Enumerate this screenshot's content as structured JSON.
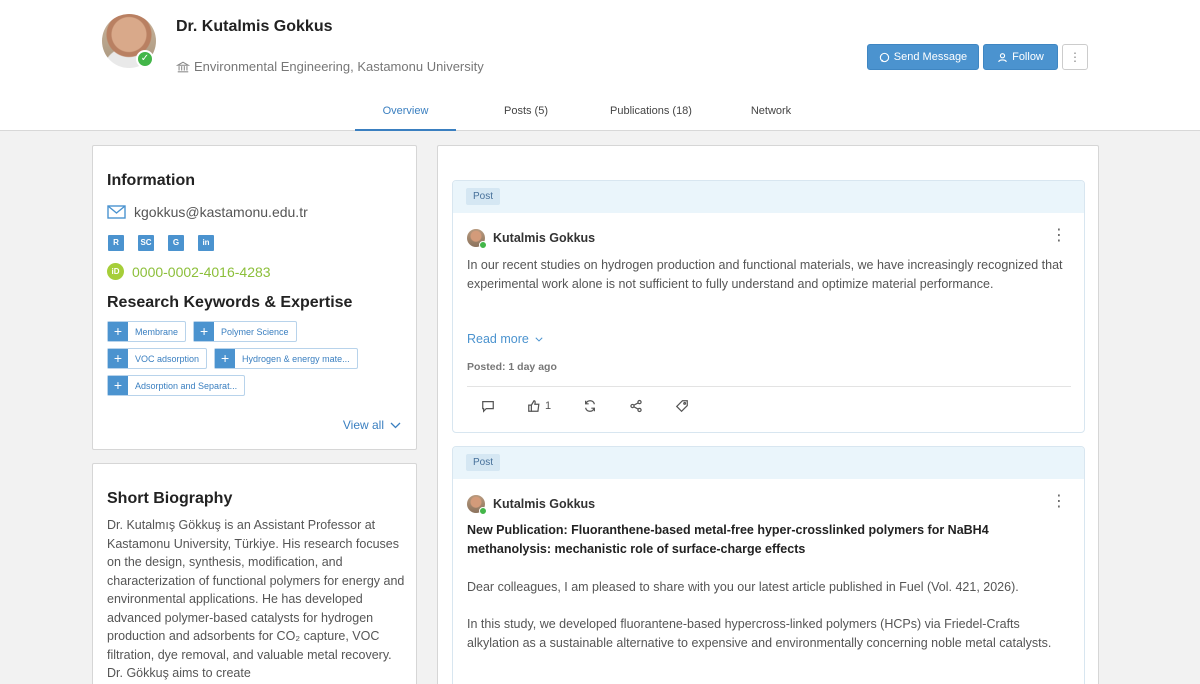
{
  "profile": {
    "name": "Dr. Kutalmis Gokkus",
    "affiliation": "Environmental Engineering, Kastamonu University"
  },
  "actions": {
    "send_message": "Send Message",
    "follow": "Follow",
    "more": "⋮"
  },
  "tabs": [
    {
      "label": "Overview",
      "active": true
    },
    {
      "label": "Posts (5)",
      "active": false
    },
    {
      "label": "Publications (18)",
      "active": false
    },
    {
      "label": "Network",
      "active": false
    }
  ],
  "info": {
    "title": "Information",
    "email": "kgokkus@kastamonu.edu.tr",
    "social": [
      "R",
      "SC",
      "G",
      "in"
    ],
    "orcid_badge": "iD",
    "orcid": "0000-0002-4016-4283",
    "keywords_title": "Research Keywords & Expertise",
    "keywords": [
      "Membrane",
      "Polymer Science",
      "VOC adsorption",
      "Hydrogen & energy mate...",
      "Adsorption and Separat..."
    ],
    "view_all": "View all"
  },
  "bio": {
    "title": "Short Biography",
    "text": "Dr. Kutalmış Gökkuş is an Assistant Professor at Kastamonu University, Türkiye. His research focuses on the design, synthesis, modification, and characterization of functional polymers for energy and environmental applications. He has developed advanced polymer-based catalysts for hydrogen production and adsorbents for CO₂ capture, VOC filtration, dye removal, and valuable metal recovery. Dr. Gökkuş aims to create"
  },
  "posts": [
    {
      "badge": "Post",
      "author": "Kutalmis Gokkus",
      "text": "In our recent studies on hydrogen production and functional materials, we have increasingly recognized that experimental work alone is not sufficient to fully understand and optimize material performance.",
      "read_more": "Read more",
      "posted": "Posted: 1 day ago",
      "likes": "1"
    },
    {
      "badge": "Post",
      "author": "Kutalmis Gokkus",
      "title": "New Publication: Fluoranthene-based metal-free hyper-crosslinked polymers for NaBH4 methanolysis: mechanistic role of surface-charge effects",
      "para1": "Dear colleagues, I am pleased to share with you our latest article published in Fuel (Vol. 421, 2026).",
      "para2": "In this study, we developed fluorantene-based hypercross-linked polymers (HCPs) via Friedel-Crafts alkylation as a sustainable alternative to expensive and environmentally concerning noble metal catalysts."
    }
  ],
  "colors": {
    "accent": "#4b93cf",
    "orcid": "#a6ce39",
    "online": "#43b649"
  }
}
